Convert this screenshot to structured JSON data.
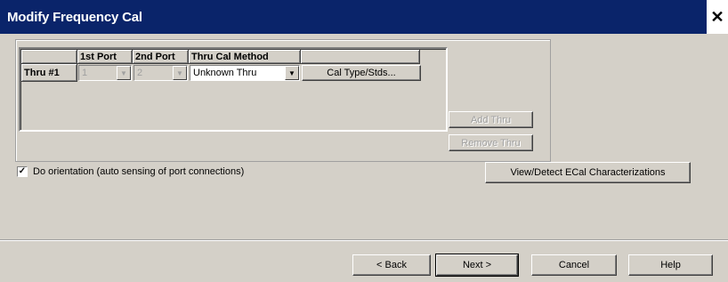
{
  "window": {
    "title": "Modify Frequency Cal",
    "close_symbol": "✕"
  },
  "grid": {
    "columns": [
      "",
      "1st Port",
      "2nd Port",
      "Thru Cal Method",
      ""
    ],
    "rows": [
      {
        "label": "Thru #1",
        "port1": "1",
        "port2": "2",
        "method": "Unknown Thru",
        "stds_button": "Cal Type/Stds..."
      }
    ]
  },
  "buttons": {
    "add_thru": "Add Thru",
    "remove_thru": "Remove Thru",
    "view_detect": "View/Detect ECal Characterizations",
    "back": "< Back",
    "next": "Next >",
    "cancel": "Cancel",
    "help": "Help"
  },
  "orientation": {
    "label": "Do orientation (auto sensing of port connections)",
    "checked": true,
    "check_symbol": "✓"
  },
  "icons": {
    "dropdown": "chevron-down-icon",
    "close": "close-icon"
  }
}
